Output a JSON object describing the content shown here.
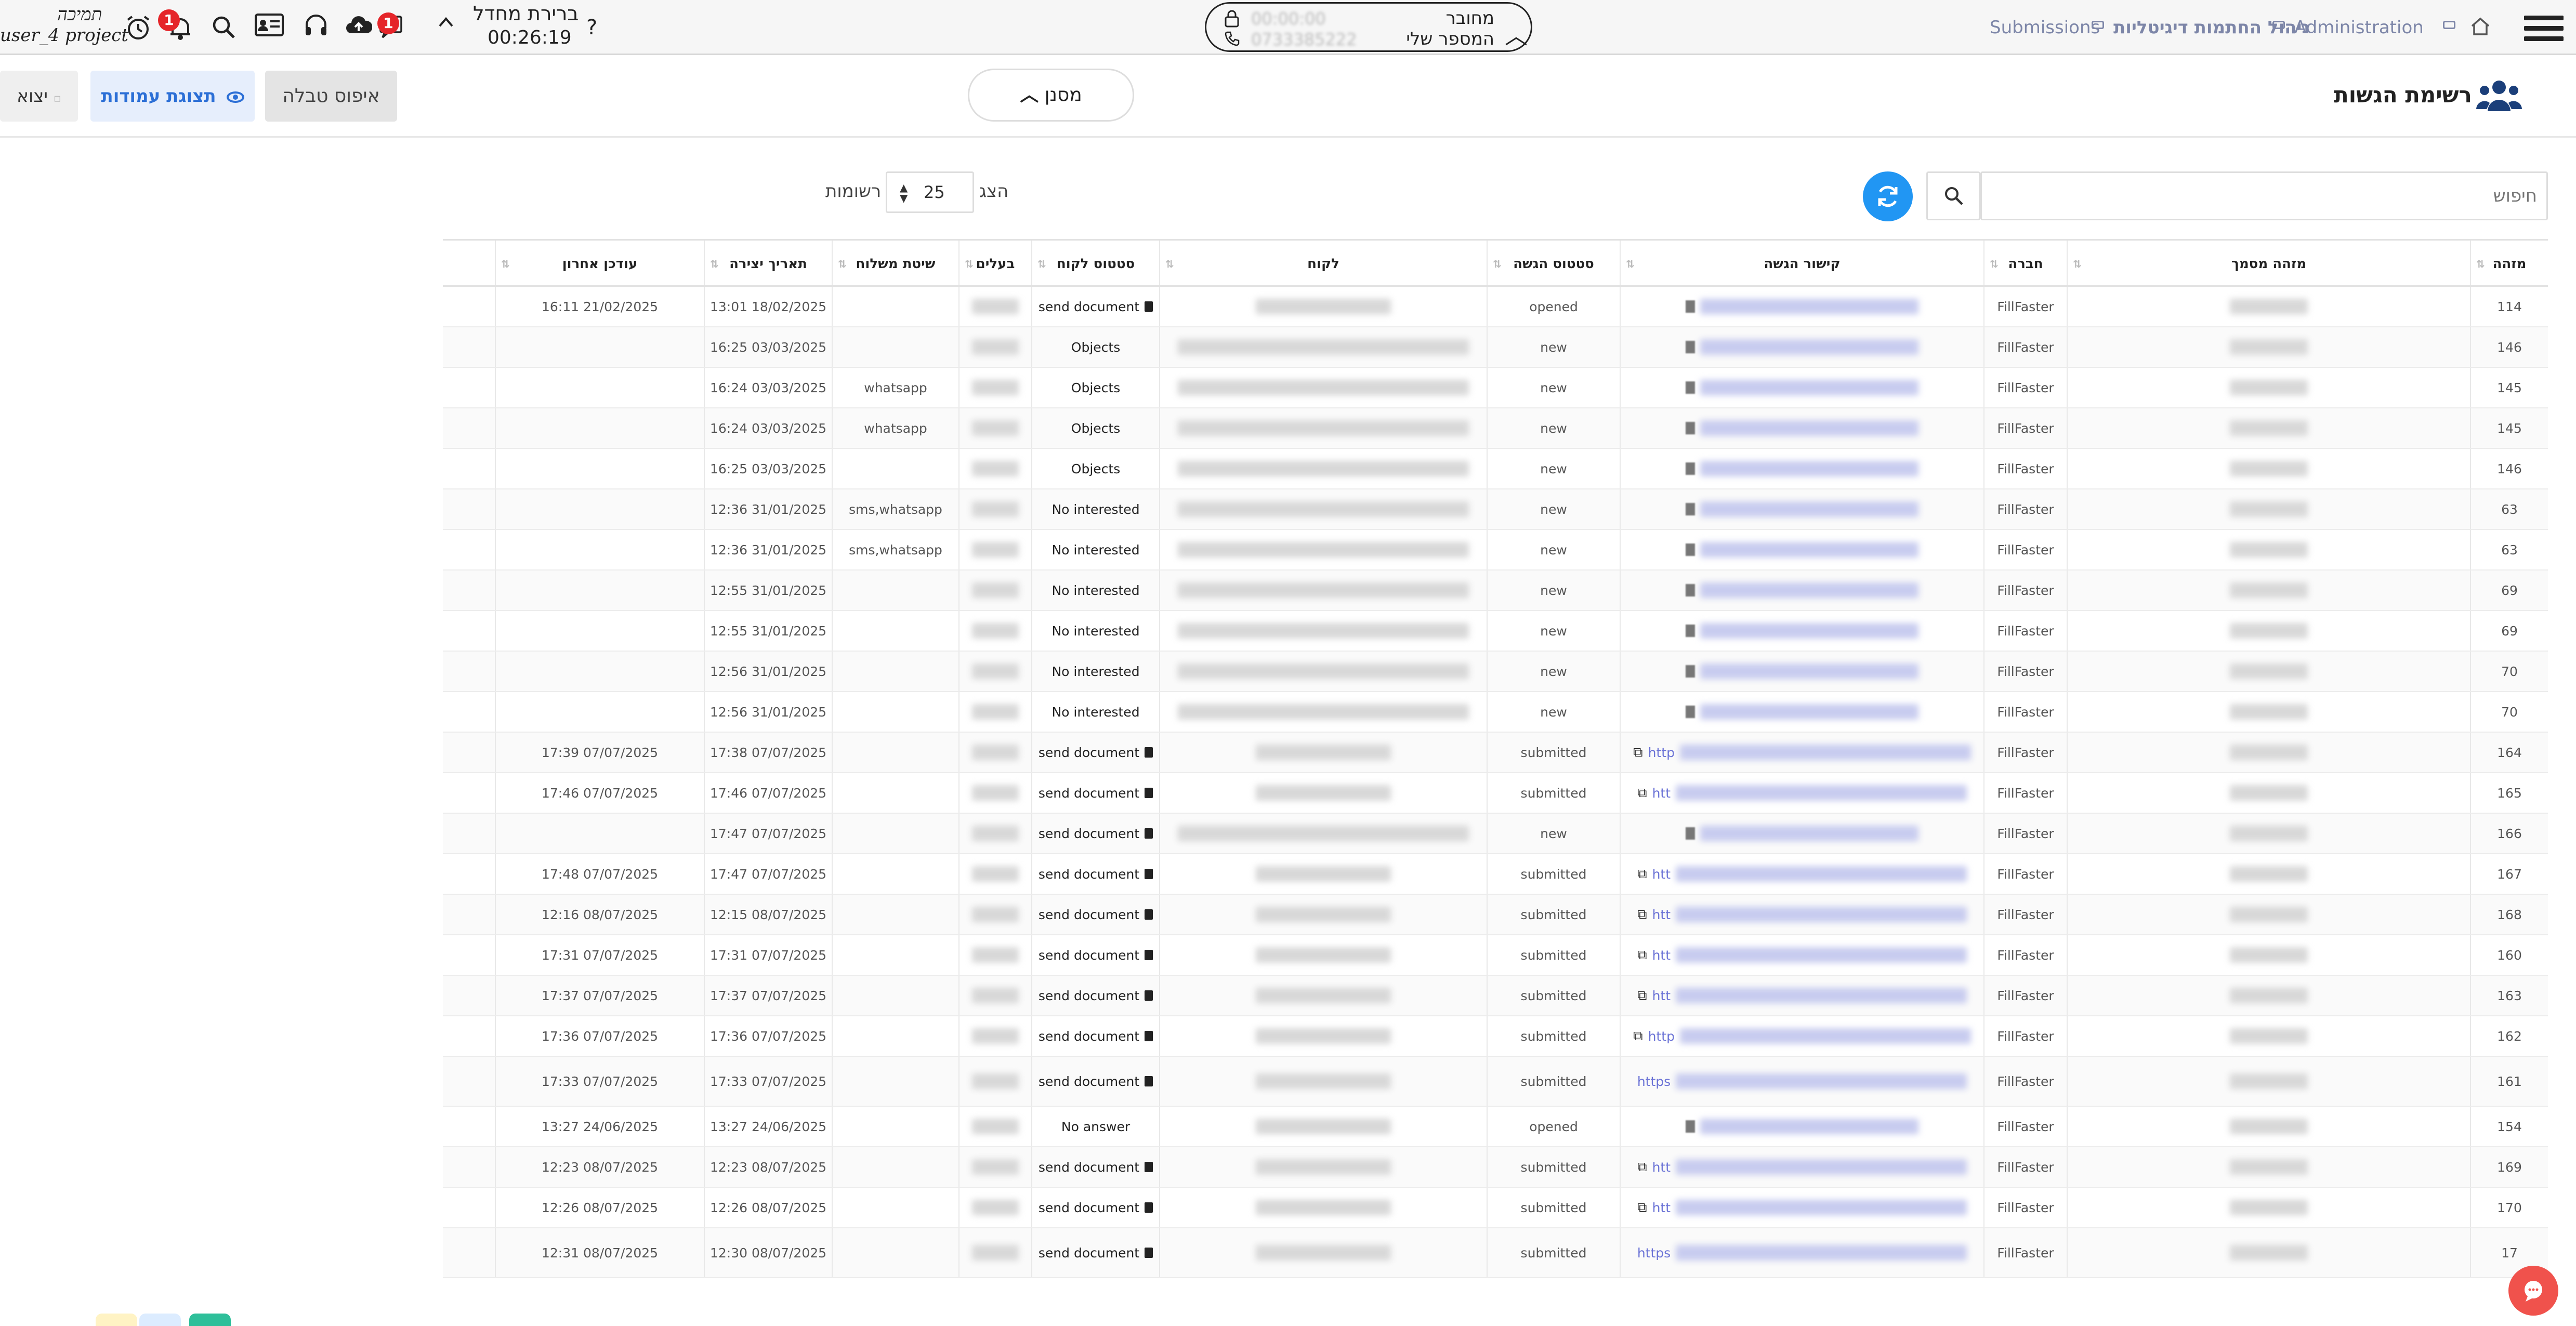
{
  "header": {
    "breadcrumb": {
      "administration": "Administration",
      "digital_signature": "ניהול החתמות דיגיטליות",
      "submissions": "Submissions"
    },
    "phone": {
      "status": "מחובר",
      "label": "המספר שלי",
      "timer_blurred": "00:00:00",
      "number_blurred": "0733385222"
    },
    "help_label": "?",
    "default_label": "ברירת מחדל",
    "session_timer": "00:26:19",
    "notifications_badge": "1",
    "messages_badge": "1",
    "user": {
      "label": "תמיכה",
      "project": "user_4 project"
    }
  },
  "page": {
    "title": "רשימת הגשות",
    "filter_label": "מסנן",
    "reset_table_label": "איפוס טבלה",
    "columns_view_label": "תצוגת עמודות",
    "export_label": "יצוא"
  },
  "search": {
    "placeholder": "חיפוש",
    "show_label": "הצג",
    "page_size": "25",
    "records_label": "רשומות"
  },
  "table": {
    "headers": [
      "מזהה",
      "מזהה מסמך",
      "חברה",
      "קישור הגשה",
      "סטטוס הגשה",
      "לקוח",
      "סטטוס לקוח",
      "בעלים",
      "שיטת משלוח",
      "תאריך יצירה",
      "עודכן אחרון"
    ],
    "rows": [
      {
        "id": "114",
        "company": "FillFaster",
        "link": "",
        "status": "opened",
        "client_status": "send document",
        "doc": true,
        "method": "",
        "created": "13:01 18/02/2025",
        "updated": "16:11 21/02/2025"
      },
      {
        "id": "146",
        "company": "FillFaster",
        "link": "",
        "status": "new",
        "client_status": "Objects",
        "doc": false,
        "method": "",
        "created": "16:25 03/03/2025",
        "updated": ""
      },
      {
        "id": "145",
        "company": "FillFaster",
        "link": "",
        "status": "new",
        "client_status": "Objects",
        "doc": false,
        "method": "whatsapp",
        "created": "16:24 03/03/2025",
        "updated": ""
      },
      {
        "id": "145",
        "company": "FillFaster",
        "link": "",
        "status": "new",
        "client_status": "Objects",
        "doc": false,
        "method": "whatsapp",
        "created": "16:24 03/03/2025",
        "updated": ""
      },
      {
        "id": "146",
        "company": "FillFaster",
        "link": "",
        "status": "new",
        "client_status": "Objects",
        "doc": false,
        "method": "",
        "created": "16:25 03/03/2025",
        "updated": ""
      },
      {
        "id": "63",
        "company": "FillFaster",
        "link": "",
        "status": "new",
        "client_status": "No interested",
        "doc": false,
        "method": "sms,whatsapp",
        "created": "12:36 31/01/2025",
        "updated": ""
      },
      {
        "id": "63",
        "company": "FillFaster",
        "link": "",
        "status": "new",
        "client_status": "No interested",
        "doc": false,
        "method": "sms,whatsapp",
        "created": "12:36 31/01/2025",
        "updated": ""
      },
      {
        "id": "69",
        "company": "FillFaster",
        "link": "",
        "status": "new",
        "client_status": "No interested",
        "doc": false,
        "method": "",
        "created": "12:55 31/01/2025",
        "updated": ""
      },
      {
        "id": "69",
        "company": "FillFaster",
        "link": "",
        "status": "new",
        "client_status": "No interested",
        "doc": false,
        "method": "",
        "created": "12:55 31/01/2025",
        "updated": ""
      },
      {
        "id": "70",
        "company": "FillFaster",
        "link": "",
        "status": "new",
        "client_status": "No interested",
        "doc": false,
        "method": "",
        "created": "12:56 31/01/2025",
        "updated": ""
      },
      {
        "id": "70",
        "company": "FillFaster",
        "link": "",
        "status": "new",
        "client_status": "No interested",
        "doc": false,
        "method": "",
        "created": "12:56 31/01/2025",
        "updated": ""
      },
      {
        "id": "164",
        "company": "FillFaster",
        "link": "http",
        "status": "submitted",
        "client_status": "send document",
        "doc": true,
        "method": "",
        "created": "17:38 07/07/2025",
        "updated": "17:39 07/07/2025"
      },
      {
        "id": "165",
        "company": "FillFaster",
        "link": "htt",
        "status": "submitted",
        "client_status": "send document",
        "doc": true,
        "method": "",
        "created": "17:46 07/07/2025",
        "updated": "17:46 07/07/2025"
      },
      {
        "id": "166",
        "company": "FillFaster",
        "link": "",
        "status": "new",
        "client_status": "send document",
        "doc": true,
        "method": "",
        "created": "17:47 07/07/2025",
        "updated": ""
      },
      {
        "id": "167",
        "company": "FillFaster",
        "link": "htt",
        "status": "submitted",
        "client_status": "send document",
        "doc": true,
        "method": "",
        "created": "17:47 07/07/2025",
        "updated": "17:48 07/07/2025"
      },
      {
        "id": "168",
        "company": "FillFaster",
        "link": "htt",
        "status": "submitted",
        "client_status": "send document",
        "doc": true,
        "method": "",
        "created": "12:15 08/07/2025",
        "updated": "12:16 08/07/2025"
      },
      {
        "id": "160",
        "company": "FillFaster",
        "link": "htt",
        "status": "submitted",
        "client_status": "send document",
        "doc": true,
        "method": "",
        "created": "17:31 07/07/2025",
        "updated": "17:31 07/07/2025"
      },
      {
        "id": "163",
        "company": "FillFaster",
        "link": "htt",
        "status": "submitted",
        "client_status": "send document",
        "doc": true,
        "method": "",
        "created": "17:37 07/07/2025",
        "updated": "17:37 07/07/2025"
      },
      {
        "id": "162",
        "company": "FillFaster",
        "link": "http",
        "status": "submitted",
        "client_status": "send document",
        "doc": true,
        "method": "",
        "created": "17:36 07/07/2025",
        "updated": "17:36 07/07/2025"
      },
      {
        "id": "161",
        "company": "FillFaster",
        "link": "https",
        "status": "submitted",
        "client_status": "send document",
        "doc": true,
        "method": "",
        "created": "17:33 07/07/2025",
        "updated": "17:33 07/07/2025"
      },
      {
        "id": "154",
        "company": "FillFaster",
        "link": "",
        "status": "opened",
        "client_status": "No answer",
        "doc": false,
        "method": "",
        "created": "13:27 24/06/2025",
        "updated": "13:27 24/06/2025"
      },
      {
        "id": "169",
        "company": "FillFaster",
        "link": "htt",
        "status": "submitted",
        "client_status": "send document",
        "doc": true,
        "method": "",
        "created": "12:23 08/07/2025",
        "updated": "12:23 08/07/2025"
      },
      {
        "id": "170",
        "company": "FillFaster",
        "link": "htt",
        "status": "submitted",
        "client_status": "send document",
        "doc": true,
        "method": "",
        "created": "12:26 08/07/2025",
        "updated": "12:26 08/07/2025"
      },
      {
        "id": "17",
        "company": "FillFaster",
        "link": "https",
        "status": "submitted",
        "client_status": "send document",
        "doc": true,
        "method": "",
        "created": "12:30 08/07/2025",
        "updated": "12:31 08/07/2025"
      }
    ]
  },
  "colors": {
    "accent": "#2196f3",
    "link": "#6b73d6",
    "badge": "#e5252a",
    "chat_fab": "#f0524c"
  }
}
